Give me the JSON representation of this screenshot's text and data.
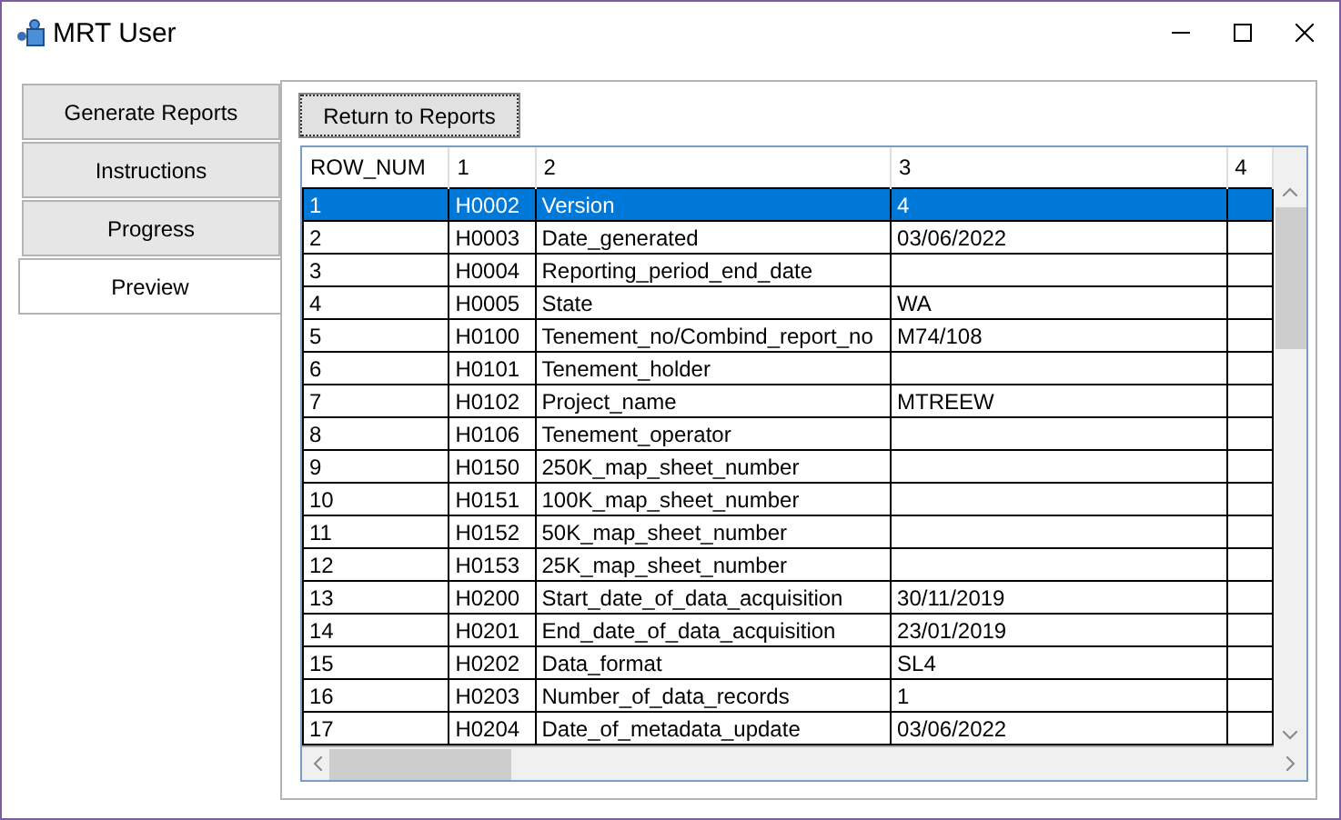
{
  "window": {
    "title": "MRT User"
  },
  "tabs": [
    {
      "label": "Generate Reports",
      "selected": false
    },
    {
      "label": "Instructions",
      "selected": false
    },
    {
      "label": "Progress",
      "selected": false
    },
    {
      "label": "Preview",
      "selected": true
    }
  ],
  "return_button": "Return to Reports",
  "table": {
    "columns": [
      "ROW_NUM",
      "1",
      "2",
      "3",
      "4"
    ],
    "rows": [
      {
        "cells": [
          "1",
          "H0002",
          "Version",
          "4",
          ""
        ],
        "selected": true
      },
      {
        "cells": [
          "2",
          "H0003",
          "Date_generated",
          "03/06/2022",
          ""
        ],
        "selected": false
      },
      {
        "cells": [
          "3",
          "H0004",
          "Reporting_period_end_date",
          "",
          ""
        ],
        "selected": false
      },
      {
        "cells": [
          "4",
          "H0005",
          "State",
          "WA",
          ""
        ],
        "selected": false
      },
      {
        "cells": [
          "5",
          "H0100",
          "Tenement_no/Combind_report_no",
          "M74/108",
          ""
        ],
        "selected": false
      },
      {
        "cells": [
          "6",
          "H0101",
          "Tenement_holder",
          "",
          ""
        ],
        "selected": false
      },
      {
        "cells": [
          "7",
          "H0102",
          "Project_name",
          "MTREEW",
          ""
        ],
        "selected": false
      },
      {
        "cells": [
          "8",
          "H0106",
          "Tenement_operator",
          "",
          ""
        ],
        "selected": false
      },
      {
        "cells": [
          "9",
          "H0150",
          "250K_map_sheet_number",
          "",
          ""
        ],
        "selected": false
      },
      {
        "cells": [
          "10",
          "H0151",
          "100K_map_sheet_number",
          "",
          ""
        ],
        "selected": false
      },
      {
        "cells": [
          "11",
          "H0152",
          "50K_map_sheet_number",
          "",
          ""
        ],
        "selected": false
      },
      {
        "cells": [
          "12",
          "H0153",
          "25K_map_sheet_number",
          "",
          ""
        ],
        "selected": false
      },
      {
        "cells": [
          "13",
          "H0200",
          "Start_date_of_data_acquisition",
          "30/11/2019",
          ""
        ],
        "selected": false
      },
      {
        "cells": [
          "14",
          "H0201",
          "End_date_of_data_acquisition",
          "23/01/2019",
          ""
        ],
        "selected": false
      },
      {
        "cells": [
          "15",
          "H0202",
          "Data_format",
          "SL4",
          ""
        ],
        "selected": false
      },
      {
        "cells": [
          "16",
          "H0203",
          "Number_of_data_records",
          "1",
          ""
        ],
        "selected": false
      },
      {
        "cells": [
          "17",
          "H0204",
          "Date_of_metadata_update",
          "03/06/2022",
          ""
        ],
        "selected": false
      }
    ]
  }
}
